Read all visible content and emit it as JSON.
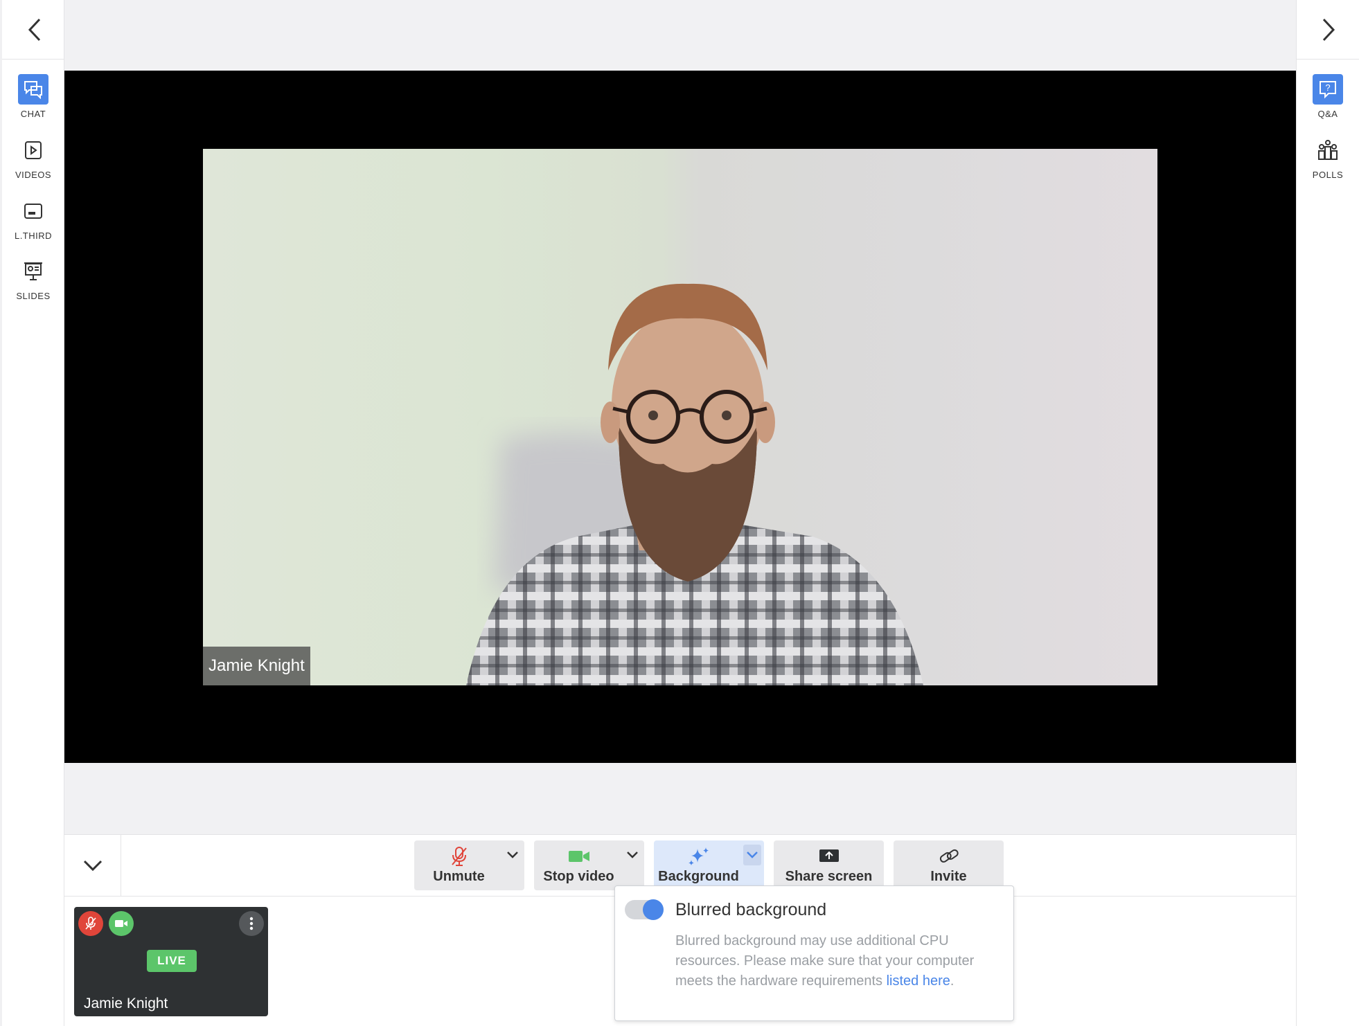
{
  "left_sidebar": {
    "items": [
      {
        "label": "CHAT",
        "icon": "chat-icon",
        "active": true
      },
      {
        "label": "VIDEOS",
        "icon": "video-play-icon",
        "active": false
      },
      {
        "label": "L.THIRD",
        "icon": "lower-third-icon",
        "active": false
      },
      {
        "label": "SLIDES",
        "icon": "slides-icon",
        "active": false
      }
    ]
  },
  "right_sidebar": {
    "items": [
      {
        "label": "Q&A",
        "icon": "question-icon",
        "active": true
      },
      {
        "label": "POLLS",
        "icon": "polls-icon",
        "active": false
      }
    ]
  },
  "stage": {
    "speaker_name": "Jamie Knight"
  },
  "controls": {
    "unmute": "Unmute",
    "stop_video": "Stop video",
    "background": "Background",
    "share_screen": "Share screen",
    "invite": "Invite"
  },
  "participant": {
    "name": "Jamie Knight",
    "status_badge": "LIVE"
  },
  "background_popup": {
    "toggle_label": "Blurred background",
    "toggle_on": true,
    "description": "Blurred background may use additional CPU resources. Please make sure that your computer meets the hardware requirements ",
    "link_text": "listed here",
    "link_suffix": "."
  },
  "colors": {
    "accent": "#4a86e8",
    "muted_red": "#e0453a",
    "video_green": "#5cc56a"
  }
}
